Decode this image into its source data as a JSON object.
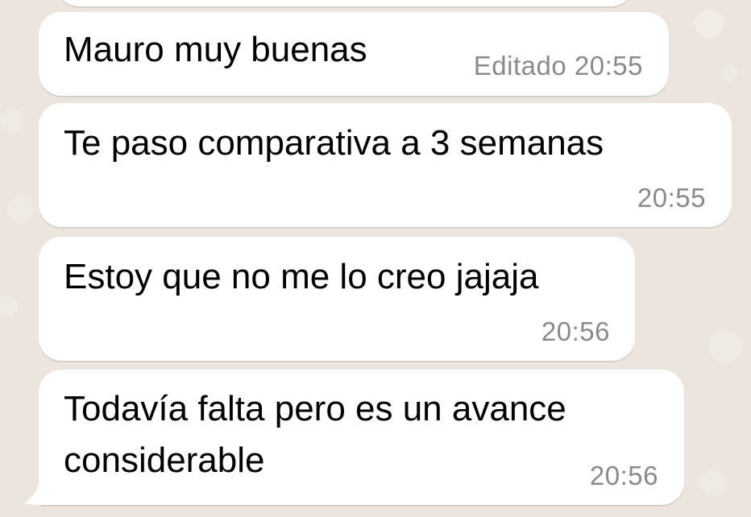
{
  "conversation": {
    "messages": [
      {
        "text": "",
        "edited_label": "",
        "time": ""
      },
      {
        "text": "Mauro muy buenas",
        "edited_label": "Editado",
        "time": "20:55"
      },
      {
        "text": "Te paso comparativa a 3 semanas",
        "edited_label": "",
        "time": "20:55"
      },
      {
        "text": "Estoy que no me lo creo jajaja",
        "edited_label": "",
        "time": "20:56"
      },
      {
        "text_line1": "Todavía falta pero es un avance",
        "text_line2": "considerable",
        "edited_label": "",
        "time": "20:56"
      }
    ]
  },
  "colors": {
    "background": "#ECE5DD",
    "bubble": "#FFFFFF",
    "timestamp": "#8A8A8A"
  }
}
